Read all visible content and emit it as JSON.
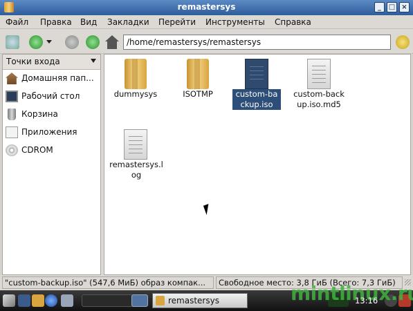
{
  "window": {
    "title": "remastersys"
  },
  "menu": [
    "Файл",
    "Правка",
    "Вид",
    "Закладки",
    "Перейти",
    "Инструменты",
    "Справка"
  ],
  "toolbar": {
    "address": "/home/remastersys/remastersys"
  },
  "sidebar": {
    "header": "Точки входа",
    "items": [
      {
        "label": "Домашняя пап...",
        "icon": "home-icon"
      },
      {
        "label": "Рабочий стол",
        "icon": "desktop-icon"
      },
      {
        "label": "Корзина",
        "icon": "trash-icon"
      },
      {
        "label": "Приложения",
        "icon": "applications-icon"
      },
      {
        "label": "CDROM",
        "icon": "cdrom-icon"
      }
    ]
  },
  "files": [
    {
      "name": "dummysys",
      "type": "folder"
    },
    {
      "name": "ISOTMP",
      "type": "folder"
    },
    {
      "name": "custom-backup.iso",
      "type": "iso",
      "selected": true
    },
    {
      "name": "custom-backup.iso.md5",
      "type": "text"
    },
    {
      "name": "remastersys.log",
      "type": "text"
    }
  ],
  "status": {
    "left": "\"custom-backup.iso\" (547,6 МиБ) образ компак...",
    "right": "Свободное место: 3,8 ГиБ (Всего: 7,3 ГиБ)"
  },
  "taskbar": {
    "task": "remastersys",
    "clock": "13:16"
  },
  "watermark": "mintlinux.ru"
}
